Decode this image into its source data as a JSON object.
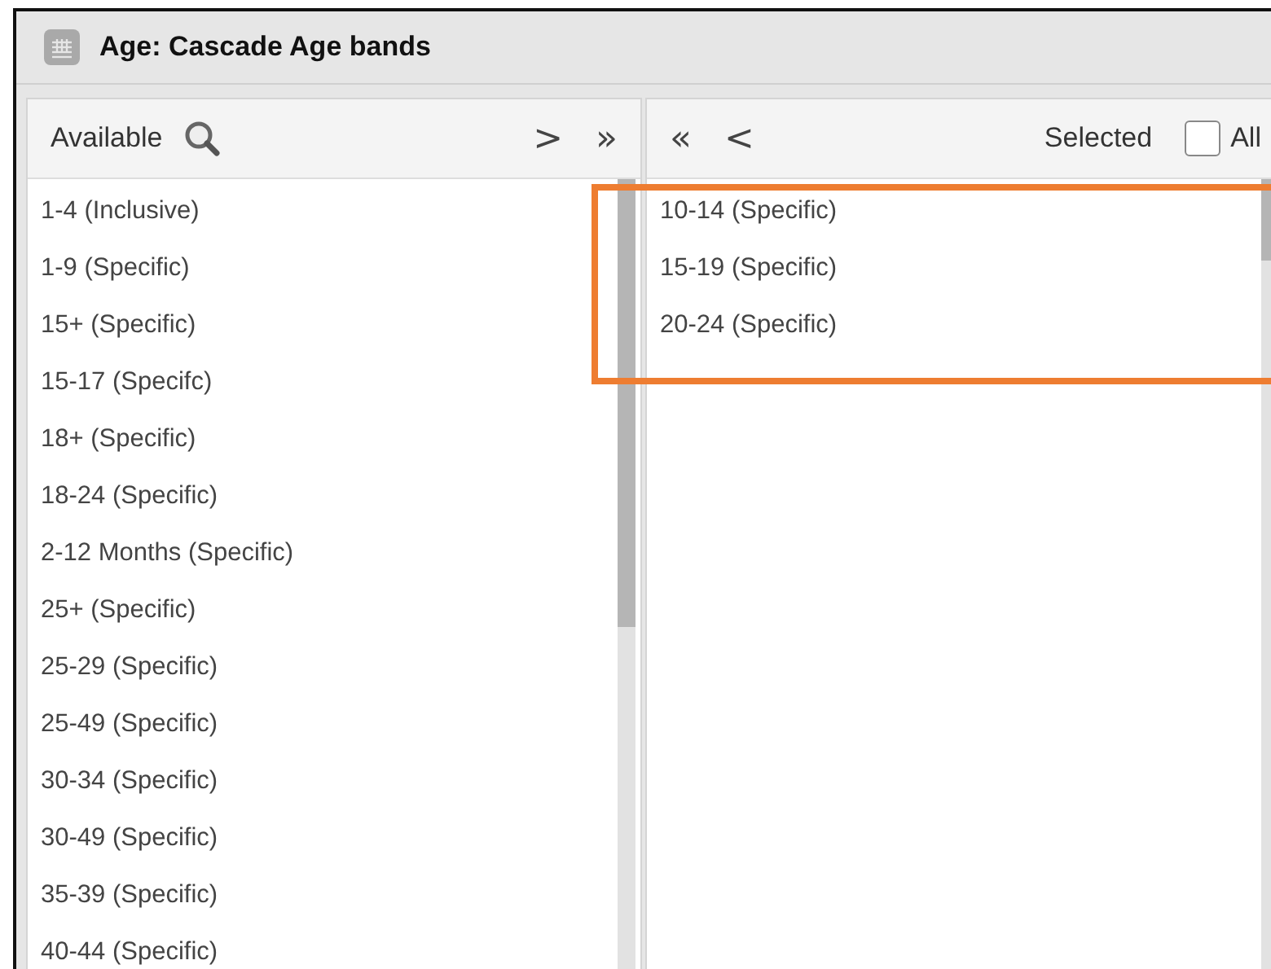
{
  "window": {
    "title": "Age: Cascade Age bands"
  },
  "available": {
    "label": "Available",
    "items": [
      "1-4 (Inclusive)",
      "1-9 (Specific)",
      "15+ (Specific)",
      "15-17 (Specifc)",
      "18+ (Specific)",
      "18-24 (Specific)",
      "2-12 Months (Specific)",
      "25+ (Specific)",
      "25-29 (Specific)",
      "25-49 (Specific)",
      "30-34 (Specific)",
      "30-49 (Specific)",
      "35-39 (Specific)",
      "40-44 (Specific)"
    ],
    "move_one": ">",
    "move_all": "»"
  },
  "selected": {
    "label": "Selected",
    "remove_all": "«",
    "remove_one": "<",
    "all_label": "All",
    "all_checked": false,
    "items": [
      "10-14 (Specific)",
      "15-19 (Specific)",
      "20-24 (Specific)"
    ],
    "highlighted": true
  }
}
